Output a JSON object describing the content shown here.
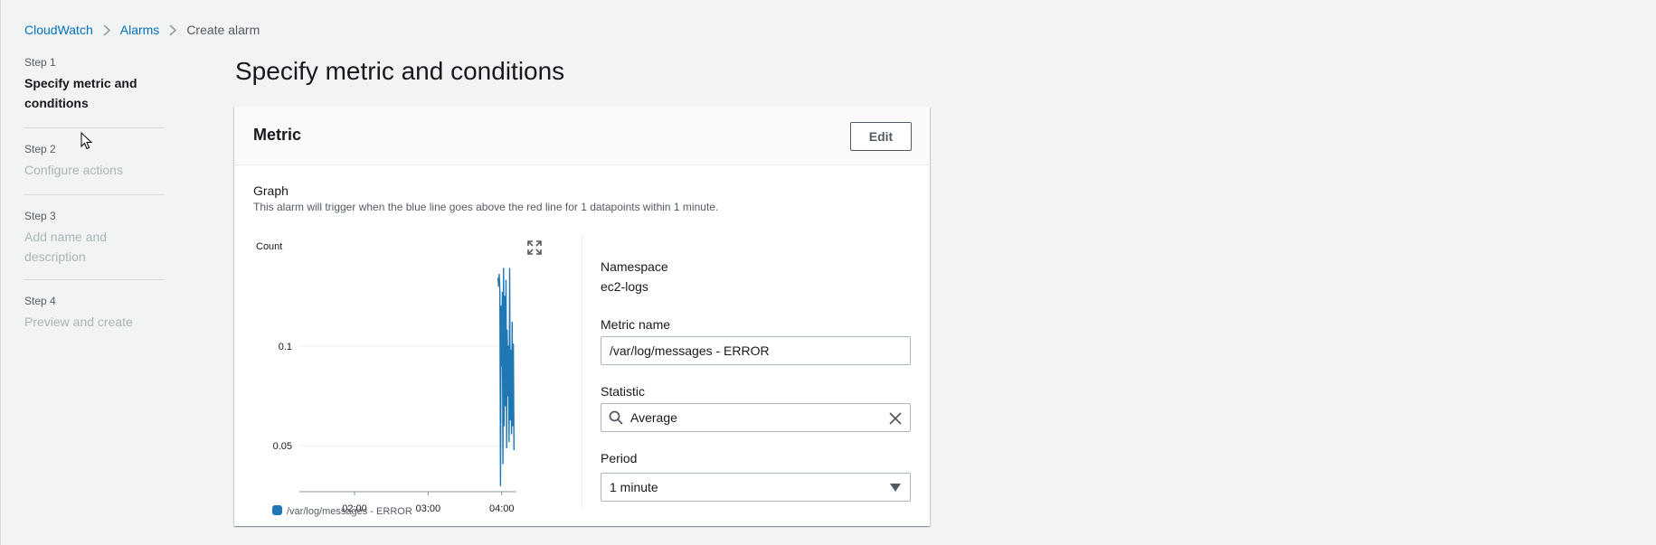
{
  "breadcrumb": {
    "items": [
      "CloudWatch",
      "Alarms"
    ],
    "current": "Create alarm"
  },
  "steps": [
    {
      "num": "Step 1",
      "title": "Specify metric and conditions"
    },
    {
      "num": "Step 2",
      "title": "Configure actions"
    },
    {
      "num": "Step 3",
      "title": "Add name and description"
    },
    {
      "num": "Step 4",
      "title": "Preview and create"
    }
  ],
  "page_title": "Specify metric and conditions",
  "card": {
    "title": "Metric",
    "edit_label": "Edit",
    "graph_label": "Graph",
    "graph_description": "This alarm will trigger when the blue line goes above the red line for 1 datapoints within 1 minute."
  },
  "fields": {
    "namespace_label": "Namespace",
    "namespace_value": "ec2-logs",
    "metric_label": "Metric name",
    "metric_value": "/var/log/messages - ERROR",
    "statistic_label": "Statistic",
    "statistic_value": "Average",
    "period_label": "Period",
    "period_value": "1 minute"
  },
  "colors": {
    "series": "#1f77b4",
    "link": "#0073bb"
  },
  "icons": {
    "breadcrumb_separator": "chevron-right-icon",
    "expand": "expand-icon",
    "search": "search-icon",
    "clear": "close-icon",
    "dropdown": "caret-down-icon"
  },
  "chart_data": {
    "type": "line",
    "ylabel": "Count",
    "y_ticks": [
      "0.1",
      "0.05"
    ],
    "y_tick_values": [
      0.1,
      0.05
    ],
    "x_ticks": [
      "02:00",
      "03:00",
      "04:00"
    ],
    "x_tick_values": [
      120,
      180,
      240
    ],
    "xlim": [
      75,
      252
    ],
    "ylim": [
      0.027,
      0.143
    ],
    "series": [
      {
        "name": "/var/log/messages - ERROR",
        "x": [
          237,
          237.5,
          238,
          238.5,
          239,
          239.5,
          240,
          240.5,
          241,
          241.5,
          242,
          242.5,
          243,
          243.5,
          244,
          244.5,
          245,
          245.5,
          246,
          246.5,
          247,
          247.5,
          248,
          248.5,
          249,
          249.5,
          250
        ],
        "values": [
          0.134,
          0.13,
          0.136,
          0.128,
          0.03,
          0.12,
          0.09,
          0.127,
          0.041,
          0.139,
          0.06,
          0.125,
          0.07,
          0.133,
          0.049,
          0.108,
          0.075,
          0.1,
          0.052,
          0.139,
          0.063,
          0.098,
          0.056,
          0.112,
          0.06,
          0.101,
          0.048
        ]
      }
    ],
    "legend": "bottom-left",
    "grid": true
  }
}
